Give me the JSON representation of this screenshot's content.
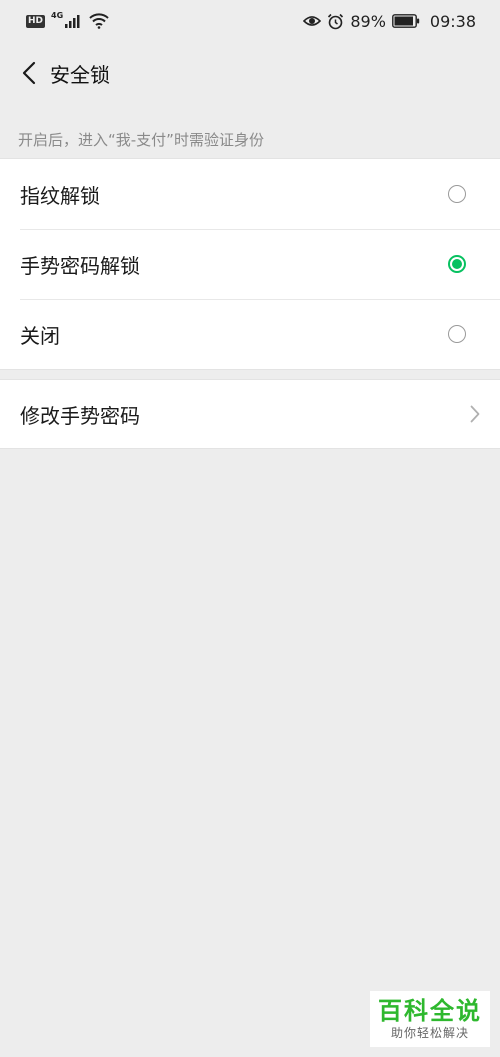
{
  "status_bar": {
    "hd": "HD",
    "network": "4G",
    "battery": "89%",
    "time": "09:38"
  },
  "header": {
    "title": "安全锁"
  },
  "section": {
    "description": "开启后，进入“我-支付”时需验证身份"
  },
  "options": [
    {
      "label": "指纹解锁",
      "selected": false
    },
    {
      "label": "手势密码解锁",
      "selected": true
    },
    {
      "label": "关闭",
      "selected": false
    }
  ],
  "modify": {
    "label": "修改手势密码"
  },
  "watermark": {
    "title": "百科全说",
    "subtitle": "助你轻松解决"
  },
  "colors": {
    "accent": "#07c160",
    "background": "#ededed"
  }
}
